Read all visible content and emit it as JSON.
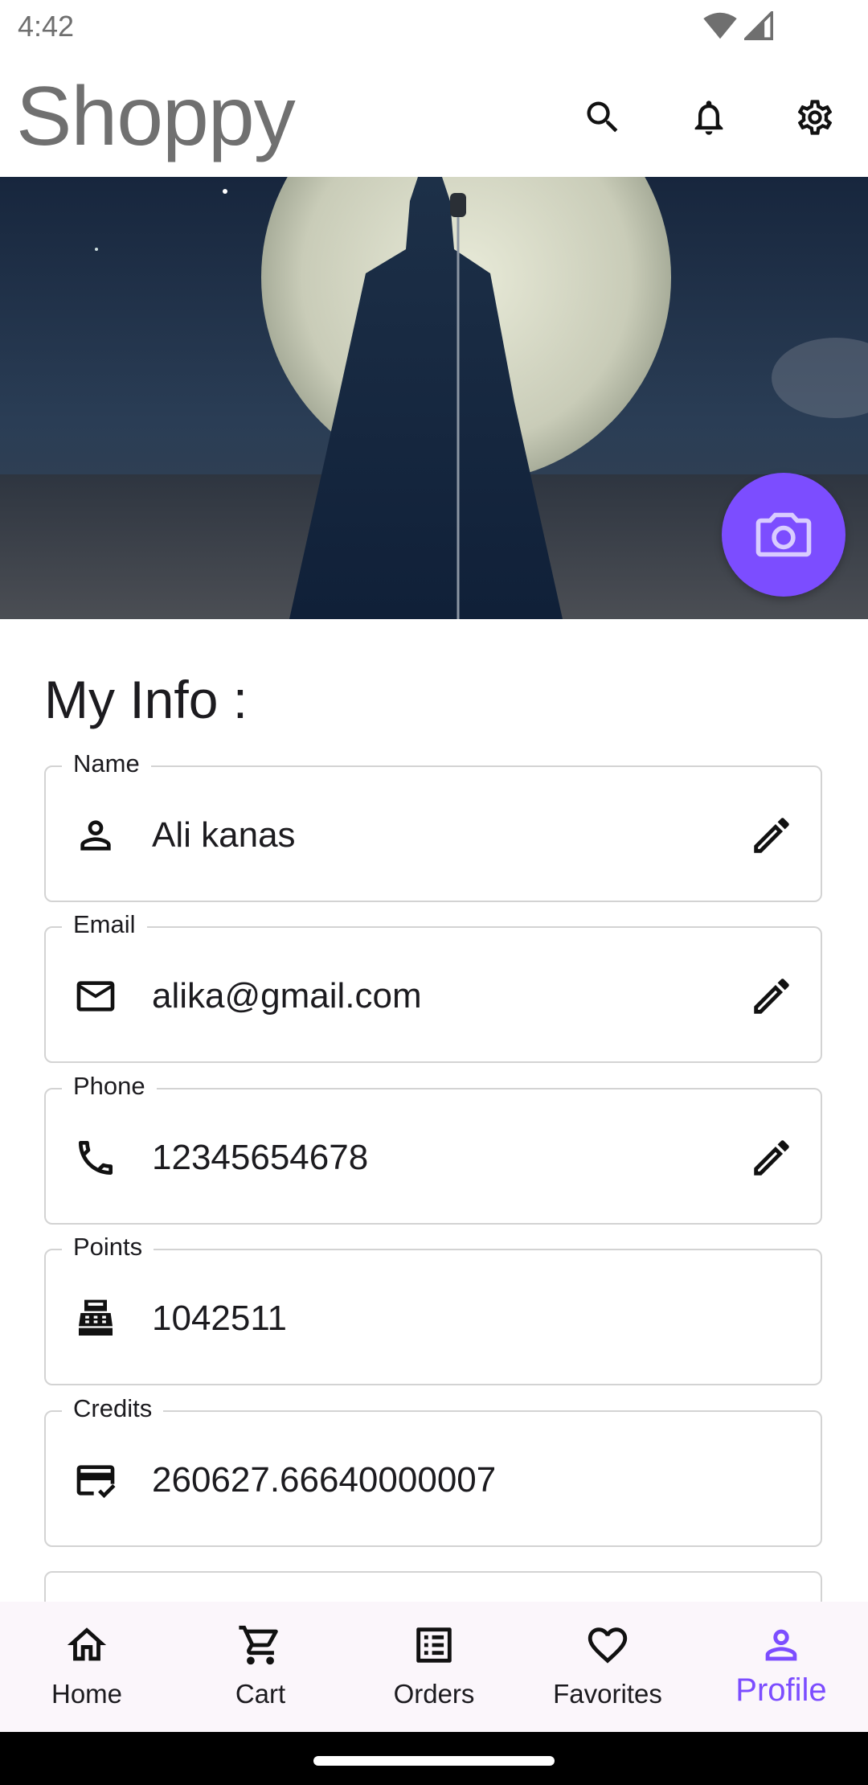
{
  "status_bar": {
    "time": "4:42"
  },
  "app_bar": {
    "title": "Shoppy",
    "actions": [
      "search-icon",
      "bell-icon",
      "gear-icon"
    ]
  },
  "banner": {
    "camera_button_icon": "camera-icon"
  },
  "section": {
    "title": "My Info :"
  },
  "fields": [
    {
      "label": "Name",
      "value": "Ali kanas",
      "icon": "person-icon",
      "editable": true
    },
    {
      "label": "Email",
      "value": "alika@gmail.com",
      "icon": "mail-icon",
      "editable": true
    },
    {
      "label": "Phone",
      "value": "12345654678",
      "icon": "phone-icon",
      "editable": true
    },
    {
      "label": "Points",
      "value": "1042511",
      "icon": "cash-register-icon",
      "editable": false
    },
    {
      "label": "Credits",
      "value": "260627.66640000007",
      "icon": "credit-card-check-icon",
      "editable": false
    }
  ],
  "bottom_nav": {
    "items": [
      {
        "label": "Home",
        "icon": "home-icon"
      },
      {
        "label": "Cart",
        "icon": "cart-icon"
      },
      {
        "label": "Orders",
        "icon": "orders-list-icon"
      },
      {
        "label": "Favorites",
        "icon": "heart-icon"
      },
      {
        "label": "Profile",
        "icon": "profile-icon",
        "active": true
      }
    ]
  },
  "colors": {
    "accent": "#7c4dff",
    "title_gray": "#707070",
    "nav_bg": "#fbf6fb",
    "field_border": "#d3d3d3"
  }
}
